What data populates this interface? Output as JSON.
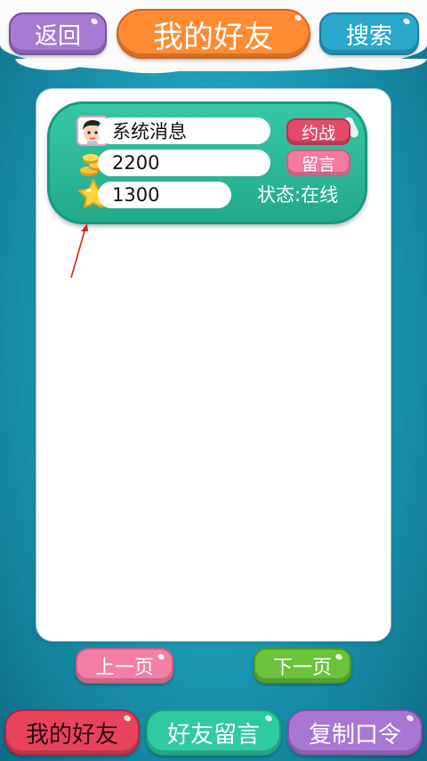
{
  "header": {
    "back_label": "返回",
    "title": "我的好友",
    "search_label": "搜索"
  },
  "friend_card": {
    "name": "系统消息",
    "coins": "2200",
    "stars": "1300",
    "battle_label": "约战",
    "message_label": "留言",
    "status": "状态:在线",
    "avatar_icon": "boy-avatar-icon",
    "coin_icon": "gold-coins-icon",
    "star_icon": "star-icon"
  },
  "pagination": {
    "prev_label": "上一页",
    "next_label": "下一页"
  },
  "bottom_tabs": {
    "my_friends": "我的好友",
    "friend_messages": "好友留言",
    "copy_code": "复制口令"
  },
  "colors": {
    "background": "#1f9fb8",
    "title_orange": "#ff8b34",
    "card_green": "#2fbf9b",
    "battle_red": "#e34b6a",
    "message_pink": "#f47aa0",
    "annotation_arrow": "#e02020"
  }
}
